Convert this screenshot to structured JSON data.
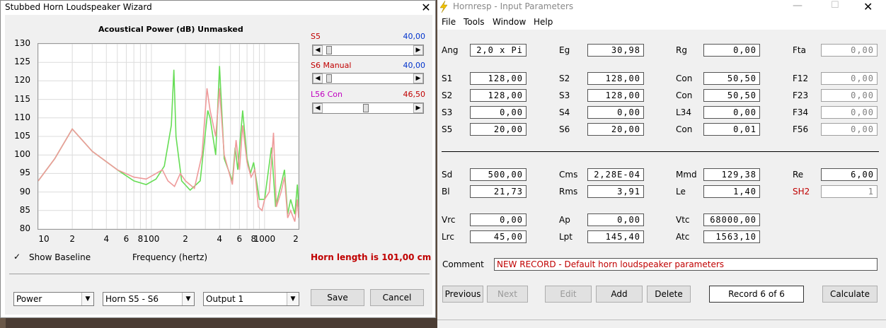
{
  "wizard": {
    "title": "Stubbed Horn Loudspeaker Wizard",
    "chart_header": "Acoustical Power (dB)   Unmasked",
    "sliders": [
      {
        "name_label": "S5",
        "value_label": "40,00",
        "position": 0.04
      },
      {
        "name_label": "S6  Manual",
        "value_label": "40,00",
        "position": 0.04
      },
      {
        "name_label": "L56  Con",
        "value_label": "46,50",
        "position": 0.47
      }
    ],
    "show_baseline_label": "Show Baseline",
    "xaxis_label": "Frequency (hertz)",
    "horn_length_text": "Horn length is 101,00 cm",
    "combo_power": "Power",
    "combo_horn": "Horn S5 - S6",
    "combo_output": "Output 1",
    "save_label": "Save",
    "cancel_label": "Cancel",
    "colors": {
      "green_series": "#66dd55",
      "pink_series": "#ee9a9a",
      "red_text": "#c00000",
      "blue_text": "#0033cc"
    }
  },
  "chart_data": {
    "type": "line",
    "title": "Acoustical Power (dB)   Unmasked",
    "xlabel": "Frequency (hertz)",
    "ylabel": "",
    "xscale": "log",
    "xlim": [
      10,
      2000
    ],
    "ylim": [
      80,
      130
    ],
    "yticks": [
      80,
      85,
      90,
      95,
      100,
      105,
      110,
      115,
      120,
      125,
      130
    ],
    "xtick_labels": [
      "10",
      "2",
      "4",
      "6",
      "8",
      "100",
      "2",
      "4",
      "6",
      "8",
      "1000",
      "2"
    ],
    "grid": true,
    "series": [
      {
        "color": "#66dd55",
        "points": [
          [
            10,
            93
          ],
          [
            14,
            99
          ],
          [
            20,
            107
          ],
          [
            30,
            101
          ],
          [
            50,
            96
          ],
          [
            70,
            93
          ],
          [
            90,
            92
          ],
          [
            110,
            93.5
          ],
          [
            130,
            97
          ],
          [
            150,
            108
          ],
          [
            158,
            123
          ],
          [
            165,
            105
          ],
          [
            185,
            93
          ],
          [
            220,
            90.5
          ],
          [
            270,
            93
          ],
          [
            315,
            112
          ],
          [
            330,
            110
          ],
          [
            370,
            100
          ],
          [
            400,
            124
          ],
          [
            440,
            99
          ],
          [
            520,
            93
          ],
          [
            550,
            102
          ],
          [
            580,
            96
          ],
          [
            640,
            112
          ],
          [
            700,
            99
          ],
          [
            750,
            95
          ],
          [
            800,
            98
          ],
          [
            900,
            88
          ],
          [
            1000,
            88
          ],
          [
            1150,
            102
          ],
          [
            1250,
            86
          ],
          [
            1400,
            92
          ],
          [
            1500,
            96
          ],
          [
            1600,
            84
          ],
          [
            1700,
            88
          ],
          [
            1850,
            84
          ],
          [
            1950,
            92
          ],
          [
            2000,
            86
          ]
        ]
      },
      {
        "color": "#ee9a9a",
        "points": [
          [
            10,
            93
          ],
          [
            14,
            99
          ],
          [
            20,
            107
          ],
          [
            30,
            101
          ],
          [
            50,
            96
          ],
          [
            70,
            94
          ],
          [
            90,
            93.5
          ],
          [
            110,
            95
          ],
          [
            125,
            96
          ],
          [
            140,
            93
          ],
          [
            160,
            91.5
          ],
          [
            180,
            95
          ],
          [
            200,
            93
          ],
          [
            240,
            91
          ],
          [
            280,
            100
          ],
          [
            310,
            118
          ],
          [
            330,
            112
          ],
          [
            370,
            105
          ],
          [
            400,
            118
          ],
          [
            440,
            100
          ],
          [
            520,
            92
          ],
          [
            560,
            104
          ],
          [
            600,
            96
          ],
          [
            640,
            108
          ],
          [
            700,
            98
          ],
          [
            760,
            94
          ],
          [
            820,
            96
          ],
          [
            880,
            86
          ],
          [
            950,
            85
          ],
          [
            1000,
            88
          ],
          [
            1100,
            90
          ],
          [
            1200,
            106
          ],
          [
            1270,
            86
          ],
          [
            1400,
            90
          ],
          [
            1500,
            94
          ],
          [
            1600,
            83
          ],
          [
            1700,
            85
          ],
          [
            1850,
            82
          ],
          [
            1950,
            88
          ],
          [
            2000,
            83
          ]
        ]
      }
    ]
  },
  "hornresp": {
    "title": "Hornresp - Input Parameters",
    "menu": [
      "File",
      "Tools",
      "Window",
      "Help"
    ],
    "params": [
      {
        "label": "Ang",
        "value": "2,0 x Pi"
      },
      {
        "label": "Eg",
        "value": "30,98"
      },
      {
        "label": "Rg",
        "value": "0,00"
      },
      {
        "label": "Fta",
        "value": "0,00"
      },
      {
        "label": "S1",
        "value": "128,00"
      },
      {
        "label": "S2",
        "value": "128,00"
      },
      {
        "label": "Con",
        "value": "50,50"
      },
      {
        "label": "F12",
        "value": "0,00"
      },
      {
        "label": "S2",
        "value": "128,00"
      },
      {
        "label": "S3",
        "value": "128,00"
      },
      {
        "label": "Con",
        "value": "50,50"
      },
      {
        "label": "F23",
        "value": "0,00"
      },
      {
        "label": "S3",
        "value": "0,00"
      },
      {
        "label": "S4",
        "value": "0,00"
      },
      {
        "label": "L34",
        "value": "0,00"
      },
      {
        "label": "F34",
        "value": "0,00"
      },
      {
        "label": "S5",
        "value": "20,00"
      },
      {
        "label": "S6",
        "value": "20,00"
      },
      {
        "label": "Con",
        "value": "0,01"
      },
      {
        "label": "F56",
        "value": "0,00"
      },
      {
        "label": "Sd",
        "value": "500,00"
      },
      {
        "label": "Cms",
        "value": "2,28E-04"
      },
      {
        "label": "Mmd",
        "value": "129,38"
      },
      {
        "label": "Re",
        "value": "6,00"
      },
      {
        "label": "Bl",
        "value": "21,73"
      },
      {
        "label": "Rms",
        "value": "3,91"
      },
      {
        "label": "Le",
        "value": "1,40"
      },
      {
        "label": "SH2",
        "value": "1"
      },
      {
        "label": "Vrc",
        "value": "0,00"
      },
      {
        "label": "Ap",
        "value": "0,00"
      },
      {
        "label": "Vtc",
        "value": "68000,00"
      },
      {
        "label": "Lrc",
        "value": "45,00"
      },
      {
        "label": "Lpt",
        "value": "145,40"
      },
      {
        "label": "Atc",
        "value": "1563,10"
      }
    ],
    "comment_label": "Comment",
    "comment_value": "NEW RECORD - Default horn loudspeaker parameters",
    "buttons": {
      "previous": "Previous",
      "next": "Next",
      "edit": "Edit",
      "add": "Add",
      "delete": "Delete",
      "calculate": "Calculate"
    },
    "record_text": "Record 6 of 6",
    "colors": {
      "sh2_label": "#c00000",
      "comment_text": "#c00000"
    }
  }
}
